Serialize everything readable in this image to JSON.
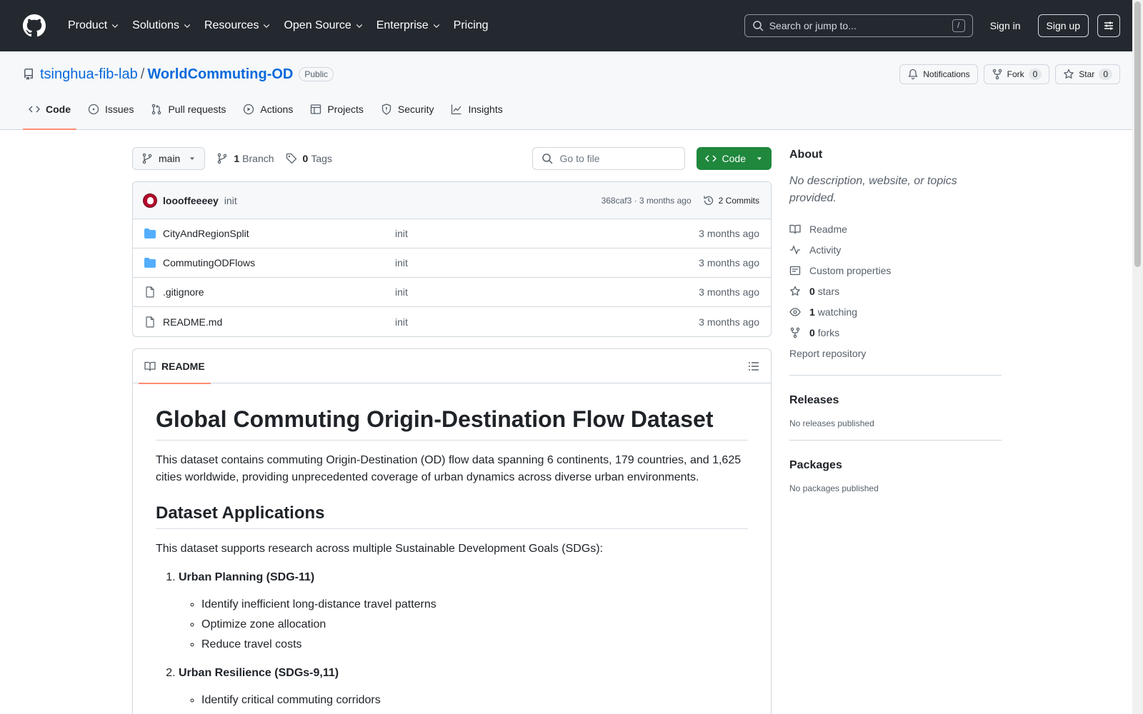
{
  "header": {
    "nav": [
      "Product",
      "Solutions",
      "Resources",
      "Open Source",
      "Enterprise",
      "Pricing"
    ],
    "search_placeholder": "Search or jump to...",
    "slash_key": "/",
    "signin": "Sign in",
    "signup": "Sign up"
  },
  "repo": {
    "owner": "tsinghua-fib-lab",
    "separator": "/",
    "name": "WorldCommuting-OD",
    "visibility": "Public",
    "notifications_label": "Notifications",
    "fork_label": "Fork",
    "fork_count": "0",
    "star_label": "Star",
    "star_count": "0"
  },
  "tabs": [
    "Code",
    "Issues",
    "Pull requests",
    "Actions",
    "Projects",
    "Security",
    "Insights"
  ],
  "filenav": {
    "branch": "main",
    "branch_count": "1",
    "branch_label": "Branch",
    "tag_count": "0",
    "tag_label": "Tags",
    "goto_placeholder": "Go to file",
    "code_label": "Code"
  },
  "commit": {
    "author": "loooffeeeey",
    "message": "init",
    "meta": "368caf3 · 3 months ago",
    "commits_label": "2 Commits"
  },
  "files": [
    {
      "name": "CityAndRegionSplit",
      "type": "folder",
      "message": "init",
      "time": "3 months ago"
    },
    {
      "name": "CommutingODFlows",
      "type": "folder",
      "message": "init",
      "time": "3 months ago"
    },
    {
      "name": ".gitignore",
      "type": "file",
      "message": "init",
      "time": "3 months ago"
    },
    {
      "name": "README.md",
      "type": "file",
      "message": "init",
      "time": "3 months ago"
    }
  ],
  "readme": {
    "tab_label": "README",
    "title": "Global Commuting Origin-Destination Flow Dataset",
    "intro": "This dataset contains commuting Origin-Destination (OD) flow data spanning 6 continents, 179 countries, and 1,625 cities worldwide, providing unprecedented coverage of urban dynamics across diverse urban environments.",
    "h2": "Dataset Applications",
    "applications_intro": "This dataset supports research across multiple Sustainable Development Goals (SDGs):",
    "items": [
      {
        "title": "Urban Planning (SDG-11)",
        "points": [
          "Identify inefficient long-distance travel patterns",
          "Optimize zone allocation",
          "Reduce travel costs"
        ]
      },
      {
        "title": "Urban Resilience (SDGs-9,11)",
        "points": [
          "Identify critical commuting corridors"
        ]
      }
    ]
  },
  "sidebar": {
    "about_title": "About",
    "about_desc": "No description, website, or topics provided.",
    "readme": "Readme",
    "activity": "Activity",
    "custom_properties": "Custom properties",
    "stars_count": "0",
    "stars_label": "stars",
    "watching_count": "1",
    "watching_label": "watching",
    "forks_count": "0",
    "forks_label": "forks",
    "report": "Report repository",
    "releases_title": "Releases",
    "releases_empty": "No releases published",
    "packages_title": "Packages",
    "packages_empty": "No packages published"
  }
}
